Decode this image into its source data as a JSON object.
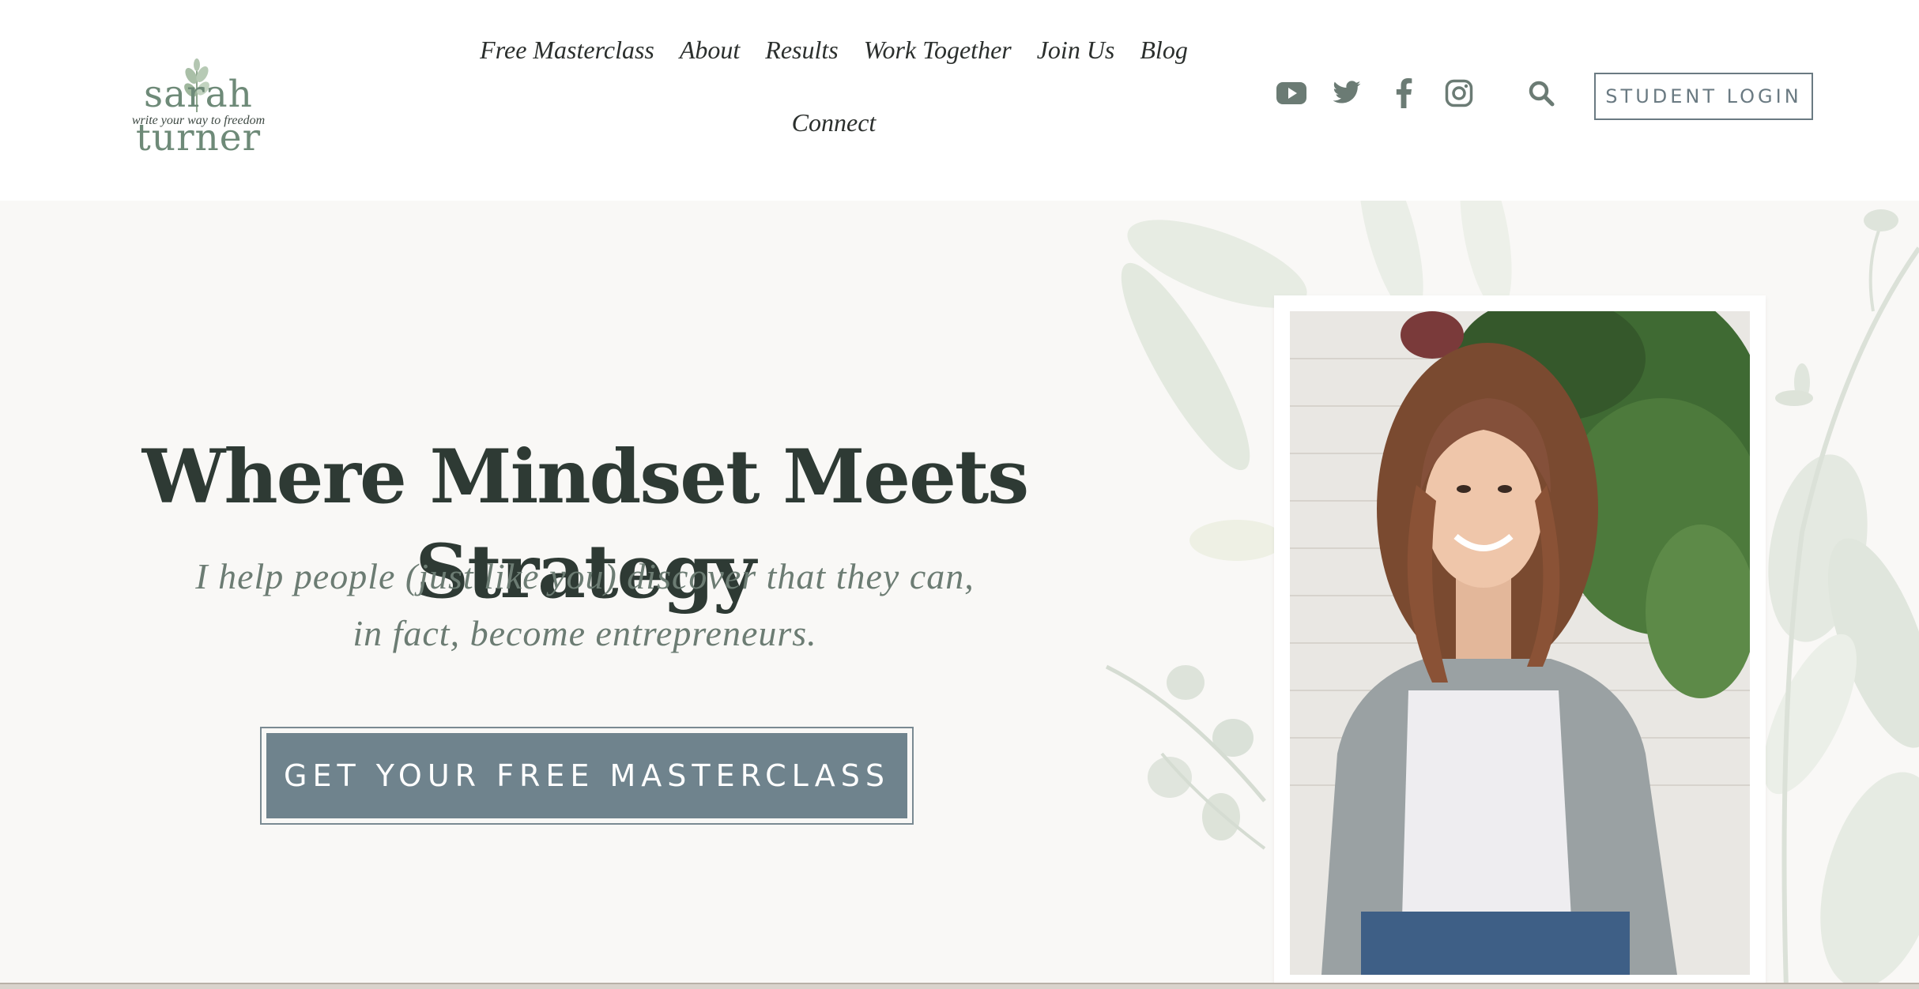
{
  "brand": {
    "name": "sarah turner",
    "tagline": "write your way to freedom"
  },
  "nav": {
    "items": [
      "Free Masterclass",
      "About",
      "Results",
      "Work Together",
      "Join Us",
      "Blog",
      "Connect"
    ]
  },
  "social": {
    "icons": [
      "youtube-icon",
      "twitter-icon",
      "facebook-icon",
      "instagram-icon",
      "search-icon"
    ]
  },
  "header": {
    "login_label": "STUDENT LOGIN"
  },
  "hero": {
    "headline": "Where Mindset Meets Strategy",
    "subtext_line1": "I help people (just like you) discover that they can,",
    "subtext_line2": "in fact, become entrepreneurs.",
    "cta_label": "GET YOUR FREE MASTERCLASS"
  },
  "colors": {
    "sage": "#6e8a78",
    "slate_button": "#6f838d",
    "headline": "#2e3a34",
    "hero_background": "#f9f8f6"
  }
}
